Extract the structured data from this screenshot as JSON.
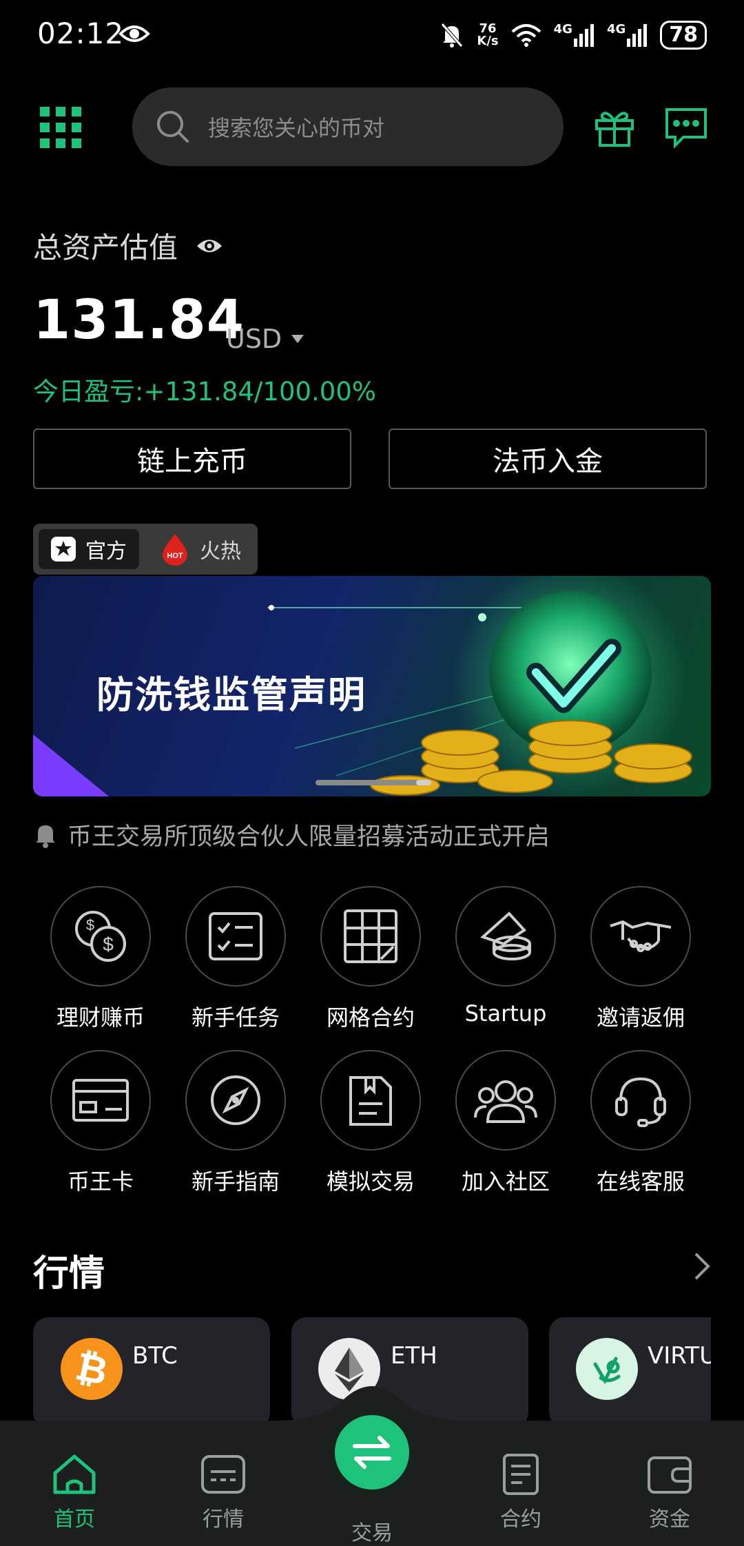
{
  "status_bar": {
    "time": "02:12",
    "speed_top": "76",
    "speed_bottom": "K/s",
    "net1": "4G",
    "net2": "4G",
    "battery": "78"
  },
  "search": {
    "placeholder": "搜索您关心的币对"
  },
  "assets": {
    "label": "总资产估值",
    "value": "131.84",
    "currency": "USD",
    "pnl": "今日盈亏:+131.84/100.00%"
  },
  "actions": {
    "deposit_chain": "链上充币",
    "fiat_deposit": "法币入金"
  },
  "tags": {
    "official": "官方",
    "hot_badge": "HOT",
    "hot": "火热"
  },
  "banner": {
    "title": "防洗钱监管声明"
  },
  "notice": {
    "text": "币王交易所顶级合伙人限量招募活动正式开启"
  },
  "quick_row1": [
    {
      "label": "理财赚币",
      "icon": "coins-icon"
    },
    {
      "label": "新手任务",
      "icon": "task-list-icon"
    },
    {
      "label": "网格合约",
      "icon": "grid-icon"
    },
    {
      "label": "Startup",
      "icon": "startup-icon"
    },
    {
      "label": "邀请返佣",
      "icon": "handshake-icon"
    }
  ],
  "quick_row2": [
    {
      "label": "币王卡",
      "icon": "card-icon"
    },
    {
      "label": "新手指南",
      "icon": "compass-icon"
    },
    {
      "label": "模拟交易",
      "icon": "document-icon"
    },
    {
      "label": "加入社区",
      "icon": "community-icon"
    },
    {
      "label": "在线客服",
      "icon": "headset-icon"
    }
  ],
  "market": {
    "title": "行情",
    "coins": [
      {
        "name": "BTC",
        "color": "#f7931a"
      },
      {
        "name": "ETH",
        "color": "#ececec"
      },
      {
        "name": "VIRTU",
        "color": "#d8f5e4"
      }
    ]
  },
  "bottom_nav": [
    {
      "label": "首页",
      "active": true
    },
    {
      "label": "行情",
      "active": false
    },
    {
      "label": "交易",
      "active": false
    },
    {
      "label": "合约",
      "active": false
    },
    {
      "label": "资金",
      "active": false
    }
  ],
  "colors": {
    "accent": "#1fc27a",
    "background": "#000000",
    "card": "#22242a",
    "nav_bg": "#1c1f1d"
  }
}
